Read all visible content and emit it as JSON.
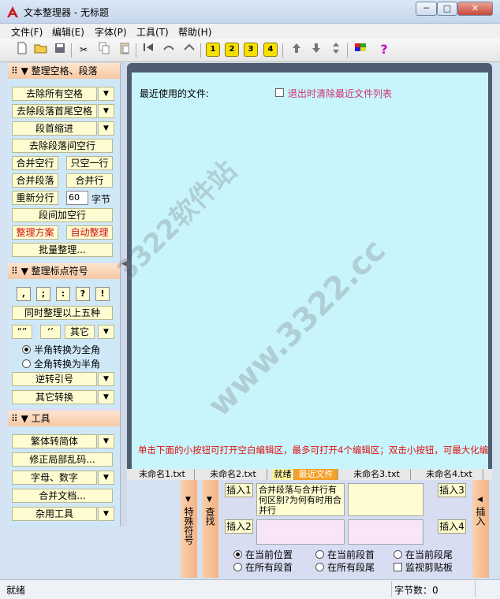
{
  "window": {
    "title": "文本整理器 - 无标题",
    "minimize": "─",
    "maximize": "□",
    "close": "✕"
  },
  "menu": [
    "文件(F)",
    "编辑(E)",
    "字体(P)",
    "工具(T)",
    "帮助(H)"
  ],
  "toolbar": {
    "num_buttons": [
      "1",
      "2",
      "3",
      "4"
    ],
    "help": "?"
  },
  "panel_format": {
    "title": "整理空格、段落",
    "remove_all_spaces": "去除所有空格",
    "remove_head_tail_spaces": "去除段落首尾空格",
    "indent": "段首缩进",
    "remove_blank_lines": "去除段落间空行",
    "merge_blank_lines": "合并空行",
    "only_one_blank": "只空一行",
    "merge_paragraphs": "合并段落",
    "merge_lines": "合并行",
    "resplit": "重新分行",
    "resplit_value": "60",
    "bytes_unit": "字节",
    "add_blank_lines": "段间加空行",
    "scheme": "整理方案",
    "auto_format": "自动整理",
    "batch": "批量整理..."
  },
  "panel_punct": {
    "title": "整理标点符号",
    "symbols": [
      ",",
      ";",
      ":",
      "?",
      "!"
    ],
    "apply_five": "同时整理以上五种",
    "quote_double": "“”",
    "quote_single": "‘’",
    "other": "其它",
    "half_to_full": "半角转换为全角",
    "full_to_half": "全角转换为半角",
    "reverse_quotes": "逆转引号",
    "other_convert": "其它转换"
  },
  "panel_tools": {
    "title": "工具",
    "trad_to_simp": "繁体转简体",
    "fix_garbled": "修正局部乱码...",
    "letters_numbers": "字母、数字",
    "merge_docs": "合并文档...",
    "misc_tools": "杂用工具"
  },
  "editor": {
    "recent_files_label": "最近使用的文件:",
    "clear_on_exit_label": "退出时清除最近文件列表",
    "hint": "单击下面的小按钮可打开空白编辑区，最多可打开4个编辑区；双击小按钮，可最大化编"
  },
  "tabs": [
    "未命名1.txt",
    "未命名2.txt",
    "就绪",
    "最近文件",
    "未命名3.txt",
    "未命名4.txt"
  ],
  "bottom": {
    "special_symbols": "特殊符号",
    "find": "查找",
    "insert_side": "插入",
    "insert1": "插入1",
    "insert2": "插入2",
    "insert3": "插入3",
    "insert4": "插入4",
    "memo_text": "合并段落与合并行有何区别?为何有时用合并行",
    "opt_current_pos": "在当前位置",
    "opt_para_start": "在当前段首",
    "opt_para_end": "在当前段尾",
    "opt_all_start": "在所有段首",
    "opt_all_end": "在所有段尾",
    "monitor_clipboard": "监视剪贴板"
  },
  "status": {
    "left": "就绪",
    "bytes": "字节数：0"
  },
  "watermarks": [
    "3322软件站",
    "www.3322.cc"
  ]
}
